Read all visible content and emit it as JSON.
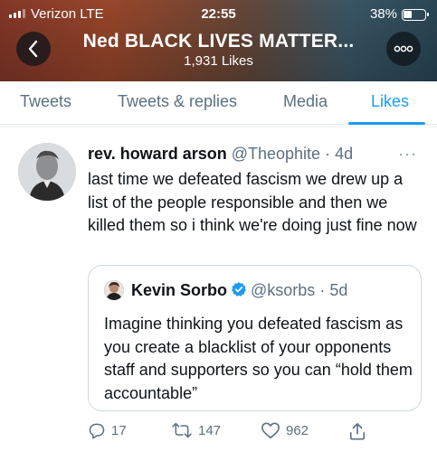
{
  "status_bar": {
    "carrier": "Verizon  LTE",
    "time": "22:55",
    "battery": "38%"
  },
  "header": {
    "name": "Ned BLACK LIVES MATTER...",
    "likes": "1,931 Likes"
  },
  "tabs": [
    {
      "label": "Tweets",
      "active": false
    },
    {
      "label": "Tweets & replies",
      "active": false
    },
    {
      "label": "Media",
      "active": false
    },
    {
      "label": "Likes",
      "active": true
    }
  ],
  "tweet": {
    "name": "rev. howard arson",
    "handle": "@Theophite",
    "time": "4d",
    "body": "last time we defeated fascism we drew up a list of the people responsible and then we killed them so i think we're doing just fine now",
    "quote": {
      "name": "Kevin Sorbo",
      "handle": "@ksorbs",
      "time": "5d",
      "body": "Imagine thinking you defeated fascism as you create a blacklist of your opponents staff and supporters so you can “hold them accountable”"
    },
    "replies": "17",
    "retweets": "147",
    "likes": "962"
  },
  "colors": {
    "accent": "#1d9bf0",
    "secondary_text": "#5b7083",
    "verified": "#1d9bf0"
  }
}
